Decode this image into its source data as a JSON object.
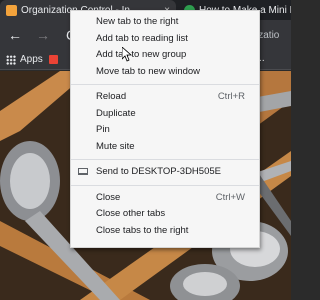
{
  "tabs": [
    {
      "title": "Organization Control - In",
      "close": "×",
      "icon": "organization-favicon-icon"
    },
    {
      "title": "How to Make a Mini Flyab",
      "icon": "tutorial-favicon-icon"
    }
  ],
  "toolbar": {
    "back": "←",
    "forward": "→",
    "reload": "C",
    "omnibox_tail": "rganizatio"
  },
  "bookmarks": {
    "apps_label": "Apps",
    "right_text": "| Fr..."
  },
  "context_menu": {
    "groups": [
      [
        {
          "label": "New tab to the right",
          "shortcut": ""
        },
        {
          "label": "Add tab to reading list",
          "shortcut": ""
        },
        {
          "label": "Add tab to new group",
          "shortcut": ""
        },
        {
          "label": "Move tab to new window",
          "shortcut": ""
        }
      ],
      [
        {
          "label": "Reload",
          "shortcut": "Ctrl+R"
        },
        {
          "label": "Duplicate",
          "shortcut": ""
        },
        {
          "label": "Pin",
          "shortcut": ""
        },
        {
          "label": "Mute site",
          "shortcut": ""
        }
      ],
      [
        {
          "label": "Send to DESKTOP-3DH505E",
          "shortcut": "",
          "icon": "device-icon"
        }
      ],
      [
        {
          "label": "Close",
          "shortcut": "Ctrl+W"
        },
        {
          "label": "Close other tabs",
          "shortcut": ""
        },
        {
          "label": "Close tabs to the right",
          "shortcut": ""
        }
      ]
    ]
  }
}
